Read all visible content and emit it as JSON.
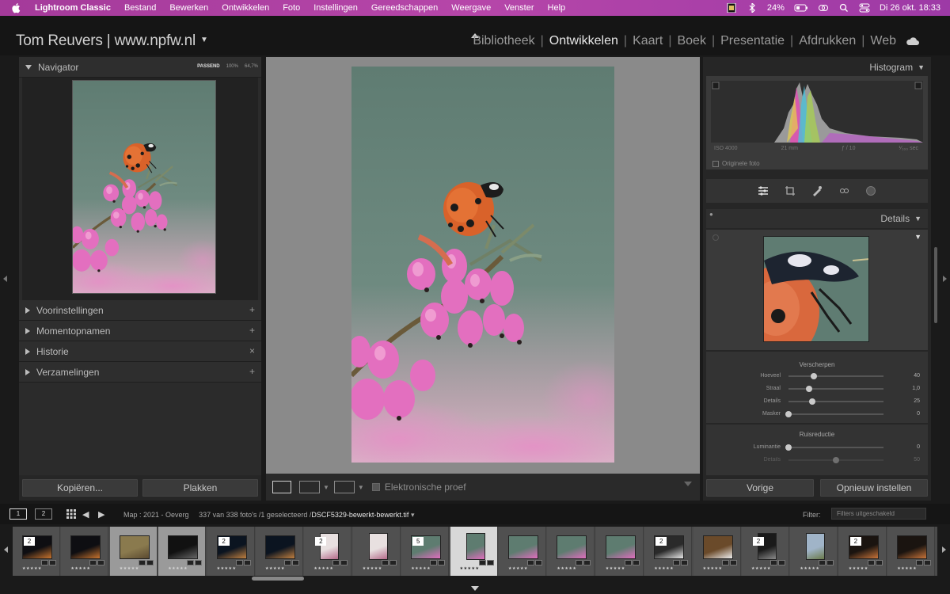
{
  "menubar": {
    "items": [
      "Lightroom Classic",
      "Bestand",
      "Bewerken",
      "Ontwikkelen",
      "Foto",
      "Instellingen",
      "Gereedschappen",
      "Weergave",
      "Venster",
      "Help"
    ],
    "battery": "24%",
    "clock": "Di 26 okt.  18:33"
  },
  "identity": {
    "title": "Tom Reuvers | www.npfw.nl"
  },
  "modules": [
    "Bibliotheek",
    "Ontwikkelen",
    "Kaart",
    "Boek",
    "Presentatie",
    "Afdrukken",
    "Web"
  ],
  "active_module": "Ontwikkelen",
  "left_panel": {
    "navigator": {
      "label": "Navigator",
      "zoom_options": [
        "PASSEND",
        "100%",
        "64,7%"
      ],
      "active_zoom": "PASSEND"
    },
    "sections": [
      {
        "label": "Voorinstellingen",
        "action": "+"
      },
      {
        "label": "Momentopnamen",
        "action": "+"
      },
      {
        "label": "Historie",
        "action": "×"
      },
      {
        "label": "Verzamelingen",
        "action": "+"
      }
    ],
    "buttons": {
      "copy": "Kopiëren...",
      "paste": "Plakken"
    }
  },
  "toolbar": {
    "proof_label": "Elektronische proef"
  },
  "right_panel": {
    "histogram": {
      "label": "Histogram",
      "iso": "ISO 4000",
      "focal": "21 mm",
      "aperture": "ƒ / 10",
      "shutter": "¹⁄₁₀₀ sec",
      "original_label": "Originele foto"
    },
    "details": {
      "label": "Details",
      "sharpen_title": "Verscherpen",
      "sharpen": [
        {
          "label": "Hoeveel",
          "value": "40",
          "pos": 0.27
        },
        {
          "label": "Straal",
          "value": "1,0",
          "pos": 0.22
        },
        {
          "label": "Details",
          "value": "25",
          "pos": 0.25
        },
        {
          "label": "Masker",
          "value": "0",
          "pos": 0.0
        }
      ],
      "noise_title": "Ruisreductie",
      "noise": [
        {
          "label": "Luminantie",
          "value": "0",
          "pos": 0.0
        },
        {
          "label": "Details",
          "value": "50",
          "pos": 0.5
        }
      ]
    },
    "buttons": {
      "previous": "Vorige",
      "reset": "Opnieuw instellen"
    }
  },
  "filmstrip_bar": {
    "monitors": [
      "1",
      "2"
    ],
    "folder": "Map : 2021 - Oeverg",
    "count": "337 van 338 foto's /1 geselecteerd /",
    "filename": "DSCF5329-bewerkt-bewerkt.tif",
    "filter_label": "Filter:",
    "filter_value": "Filters uitgeschakeld"
  },
  "filmstrip": {
    "cells": [
      {
        "stack": "2",
        "scene": "night",
        "state": "normal"
      },
      {
        "stack": "",
        "scene": "night",
        "state": "normal"
      },
      {
        "stack": "",
        "scene": "bird",
        "state": "sel"
      },
      {
        "stack": "",
        "scene": "dark",
        "state": "sel"
      },
      {
        "stack": "2",
        "scene": "city",
        "state": "normal"
      },
      {
        "stack": "",
        "scene": "city",
        "state": "normal"
      },
      {
        "stack": "2",
        "scene": "flower-light",
        "state": "normal"
      },
      {
        "stack": "",
        "scene": "flower-light",
        "state": "normal"
      },
      {
        "stack": "5",
        "scene": "pink",
        "state": "normal"
      },
      {
        "stack": "",
        "scene": "pink",
        "state": "sel-main"
      },
      {
        "stack": "",
        "scene": "pink",
        "state": "normal"
      },
      {
        "stack": "",
        "scene": "pink",
        "state": "normal"
      },
      {
        "stack": "",
        "scene": "pink",
        "state": "normal"
      },
      {
        "stack": "2",
        "scene": "swan",
        "state": "normal"
      },
      {
        "stack": "",
        "scene": "swan-brown",
        "state": "normal"
      },
      {
        "stack": "2",
        "scene": "portrait-dark",
        "state": "normal"
      },
      {
        "stack": "",
        "scene": "landscape",
        "state": "normal"
      },
      {
        "stack": "2",
        "scene": "dark-orange",
        "state": "normal"
      },
      {
        "stack": "",
        "scene": "dark-orange",
        "state": "normal"
      }
    ]
  },
  "colors": {
    "menubar": "#b646a9",
    "panel": "#2b2b2b",
    "center_bg": "#8a8a8a",
    "active_text": "#e8e8e8"
  }
}
